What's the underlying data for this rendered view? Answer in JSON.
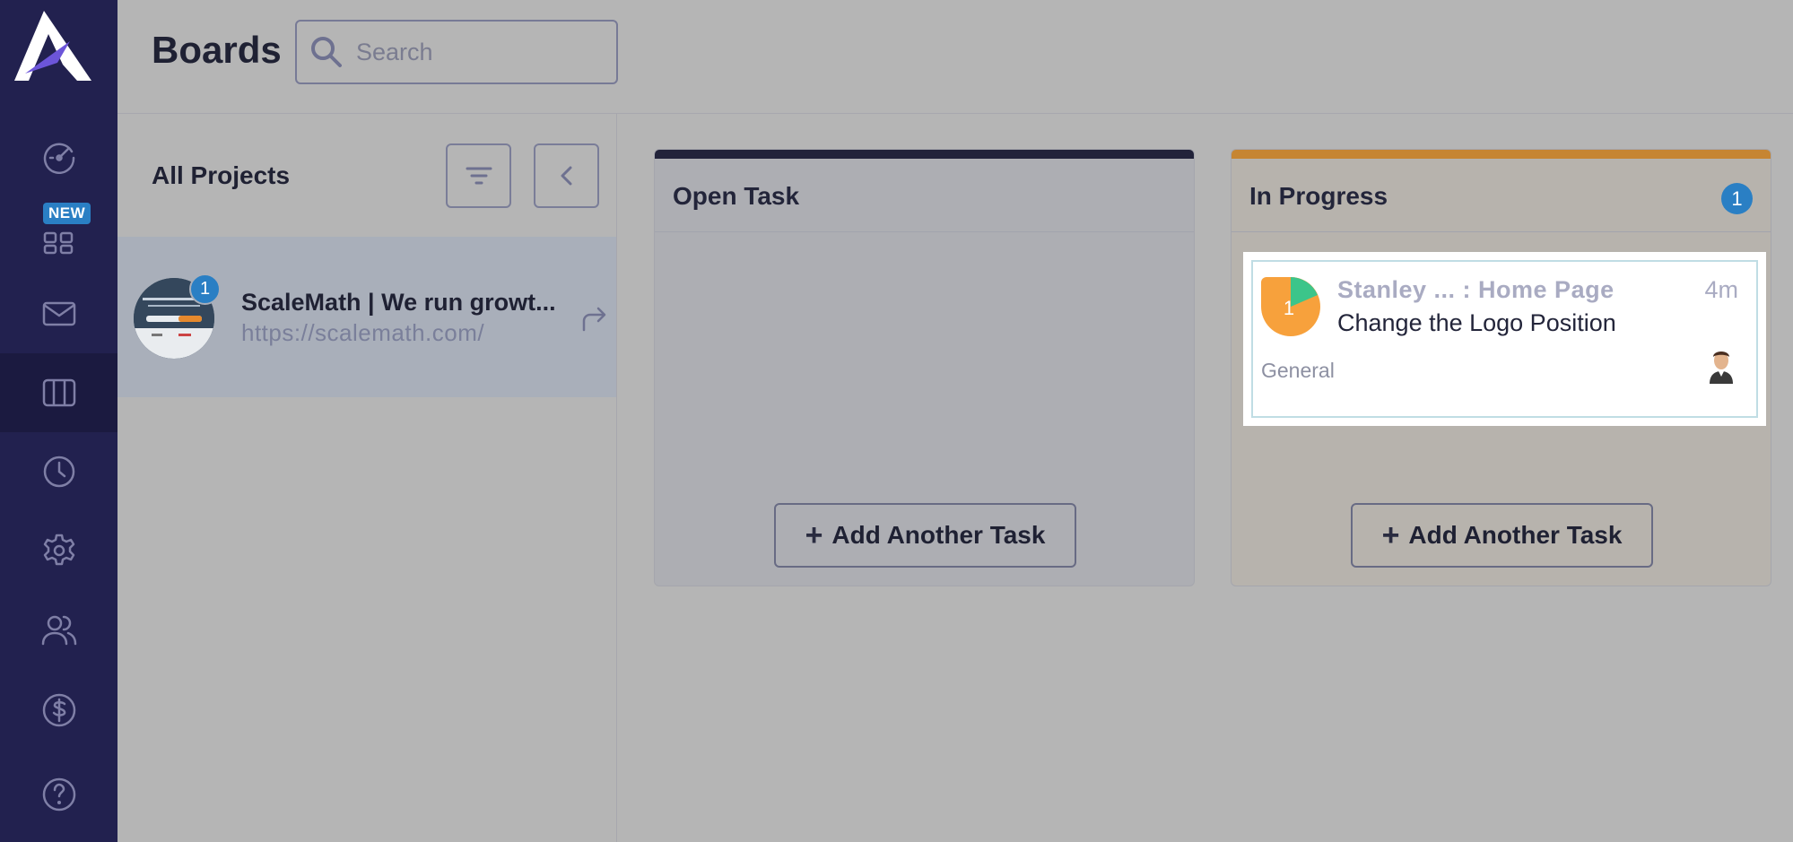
{
  "sidebar": {
    "logo": "app-logo",
    "new_badge": "NEW",
    "items": [
      {
        "name": "dashboard",
        "icon": "speedometer-icon"
      },
      {
        "name": "apps",
        "icon": "grid-icon"
      },
      {
        "name": "inbox",
        "icon": "mail-icon"
      },
      {
        "name": "boards",
        "icon": "columns-icon",
        "active": true
      },
      {
        "name": "time",
        "icon": "clock-icon"
      },
      {
        "name": "settings",
        "icon": "gear-icon"
      },
      {
        "name": "team",
        "icon": "users-icon"
      },
      {
        "name": "billing",
        "icon": "dollar-icon"
      },
      {
        "name": "help",
        "icon": "question-icon"
      }
    ]
  },
  "header": {
    "title": "Boards",
    "search_placeholder": "Search"
  },
  "projects": {
    "title": "All Projects",
    "items": [
      {
        "name": "ScaleMath | We run growt...",
        "url": "https://scalemath.com/",
        "badge": "1"
      }
    ]
  },
  "columns": [
    {
      "title": "Open Task",
      "bar_color": "#22233a",
      "add_label": "Add Another Task"
    },
    {
      "title": "In Progress",
      "bar_color": "#c68532",
      "count": "1",
      "add_label": "Add Another Task"
    }
  ],
  "task": {
    "avatar_number": "1",
    "meta": "Stanley ... : Home Page",
    "time": "4m",
    "title": "Change the Logo Position",
    "tag": "General"
  },
  "colors": {
    "sidebar": "#22214f",
    "accent_blue": "#2a7fc4",
    "in_progress_bar": "#c68532",
    "open_task_bar": "#22233a",
    "avatar_orange": "#f7a13c",
    "avatar_green": "#3cc58a"
  }
}
